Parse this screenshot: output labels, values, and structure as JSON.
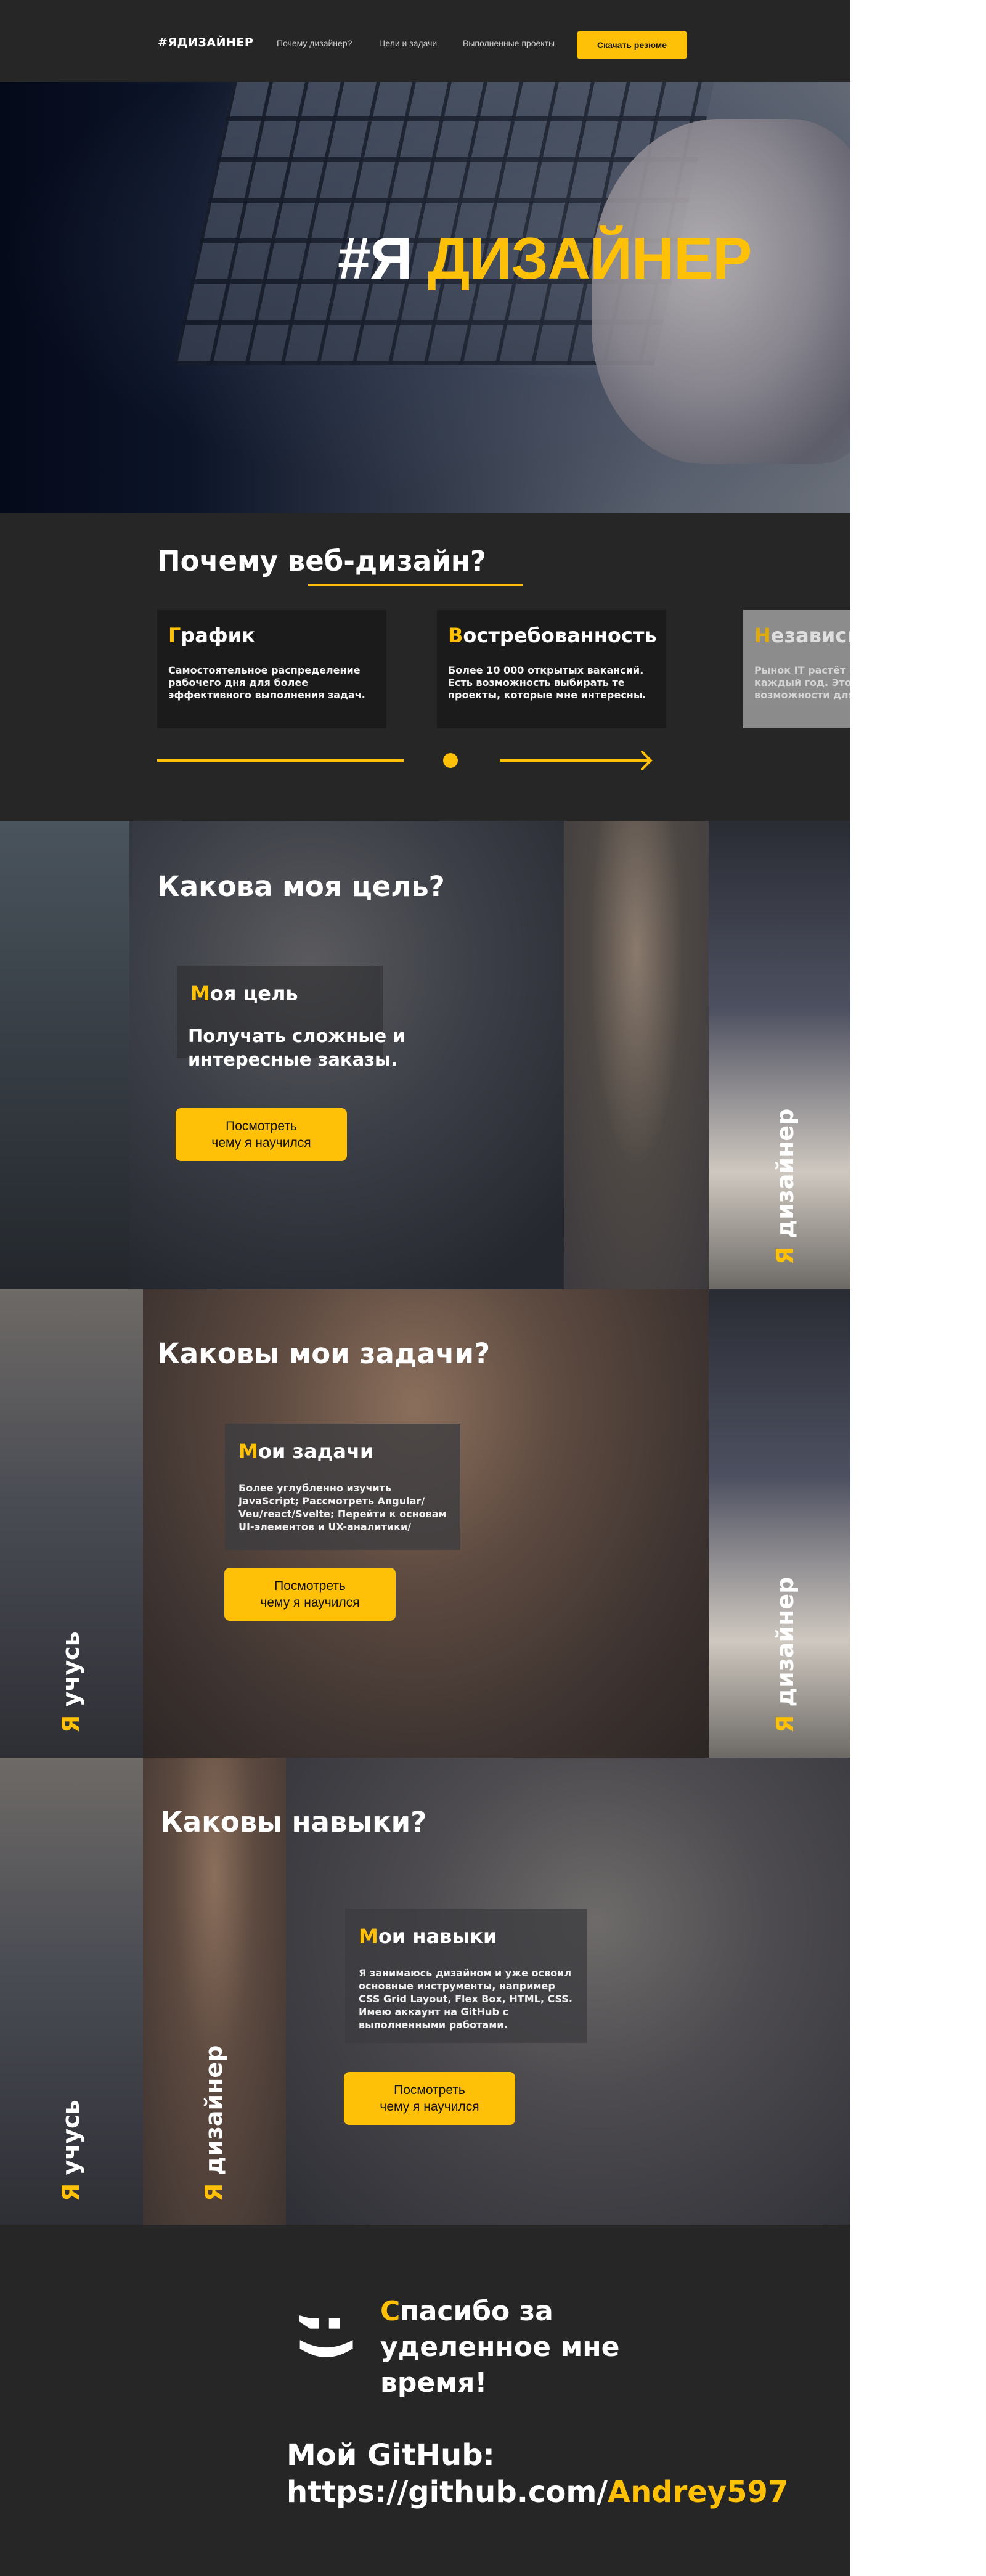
{
  "header": {
    "logo": "#ЯДИЗАЙНЕР",
    "nav": [
      "Почему дизайнер?",
      "Цели и задачи",
      "Выполненные проекты"
    ],
    "resume_button": "Скачать резюме"
  },
  "hero": {
    "title_hash": "#Я",
    "title_word": "ДИЗАЙНЕР"
  },
  "why": {
    "title": "Почему веб-дизайн?",
    "cards": [
      {
        "first": "Г",
        "rest": "рафик",
        "text": "Самостоятельное распределение рабочего дня для более эффективного выполнения задач."
      },
      {
        "first": "В",
        "rest": "остребованность",
        "text": "Более 10 000 открытых вакансий. Есть возможность выбирать те проекты, которые мне интересны."
      },
      {
        "first": "Н",
        "rest": "езависимость",
        "text": "Рынок IT растёт и развивается каждый год. Это даёт большие возможности для начинающих."
      }
    ]
  },
  "goal": {
    "title": "Какова моя цель?",
    "box_first": "М",
    "box_rest": "оя цель",
    "box_text": "Получать сложные и интересные заказы.",
    "button": "Посмотреть\nчему я научился",
    "vertical_y": "Я",
    "vertical_rest": " дизайнер"
  },
  "tasks": {
    "title": "Каковы мои задачи?",
    "box_first": "М",
    "box_rest": "ои задачи",
    "box_text": "Более углубленно изучить JavaScript; Рассмотреть Angular/ Veu/react/Svelte; Перейти к основам UI-элементов и UX-аналитики/",
    "button": "Посмотреть\nчему я научился",
    "vertical_left_y": "Я",
    "vertical_left_rest": " учусь",
    "vertical_right_y": "Я",
    "vertical_right_rest": " дизайнер"
  },
  "skills": {
    "title": "Каковы навыки?",
    "box_first": "М",
    "box_rest": "ои навыки",
    "box_text": "Я занимаюсь дизайном и уже освоил основные инструменты, например CSS Grid Layout, Flex Box, HTML, CSS. Имею аккаунт на GitHub с выполненными работами.",
    "button": "Посмотреть\nчему я научился",
    "vertical_left_y": "Я",
    "vertical_left_rest": " учусь",
    "vertical_mid_y": "Я",
    "vertical_mid_rest": " дизайнер"
  },
  "footer": {
    "smile": ";)",
    "thanks_first": "С",
    "thanks_rest": "пасибо за уделенное мне время!",
    "github_label": "Мой GitHub:",
    "github_url_prefix": "https://github.com/",
    "github_user": "Andrey597"
  },
  "colors": {
    "accent": "#ffc107",
    "background": "#262626",
    "card": "#1b1b1b"
  }
}
